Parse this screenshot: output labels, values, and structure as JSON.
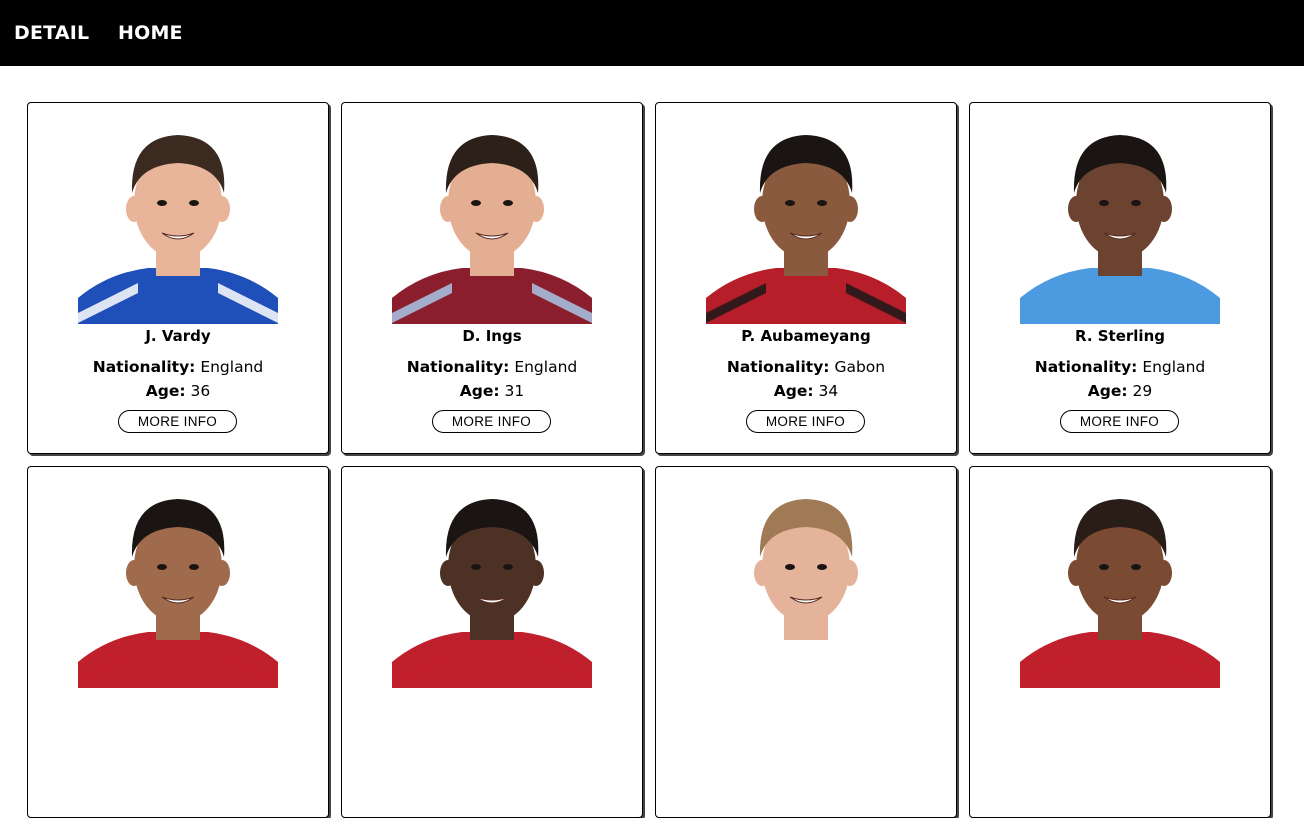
{
  "nav": {
    "detail_label": "DETAIL",
    "home_label": "HOME"
  },
  "labels": {
    "nationality": "Nationality:",
    "age": "Age:"
  },
  "players": [
    {
      "name": "J. Vardy",
      "nationality": "England",
      "age": "36",
      "button": "MORE INFO",
      "skin": "#e9b59a",
      "hair": "#3a2a20",
      "shirt": "#1f4fb8",
      "shirt2": "#ffffff"
    },
    {
      "name": "D. Ings",
      "nationality": "England",
      "age": "31",
      "button": "MORE INFO",
      "skin": "#e4ae93",
      "hair": "#2d2019",
      "shirt": "#8b1e2d",
      "shirt2": "#a9c6e8"
    },
    {
      "name": "P. Aubameyang",
      "nationality": "Gabon",
      "age": "34",
      "button": "MORE INFO",
      "skin": "#8a5a3f",
      "hair": "#1a1412",
      "shirt": "#b81e2a",
      "shirt2": "#1a1a1a"
    },
    {
      "name": "R. Sterling",
      "nationality": "England",
      "age": "29",
      "button": "MORE INFO",
      "skin": "#6b4330",
      "hair": "#1a1412",
      "shirt": "#4c9be0",
      "shirt2": "#4c9be0"
    },
    {
      "name": "",
      "nationality": "",
      "age": "",
      "button": "",
      "skin": "#a06a4c",
      "hair": "#1a1412",
      "shirt": "#c0202c",
      "shirt2": "#c0202c"
    },
    {
      "name": "",
      "nationality": "",
      "age": "",
      "button": "",
      "skin": "#4e3125",
      "hair": "#1a1412",
      "shirt": "#c0202c",
      "shirt2": "#c0202c"
    },
    {
      "name": "",
      "nationality": "",
      "age": "",
      "button": "",
      "skin": "#e4b39a",
      "hair": "#a07a55",
      "shirt": "#ffffff",
      "shirt2": "#ffffff"
    },
    {
      "name": "",
      "nationality": "",
      "age": "",
      "button": "",
      "skin": "#7a4a33",
      "hair": "#2a1c16",
      "shirt": "#c0202c",
      "shirt2": "#c0202c"
    }
  ]
}
